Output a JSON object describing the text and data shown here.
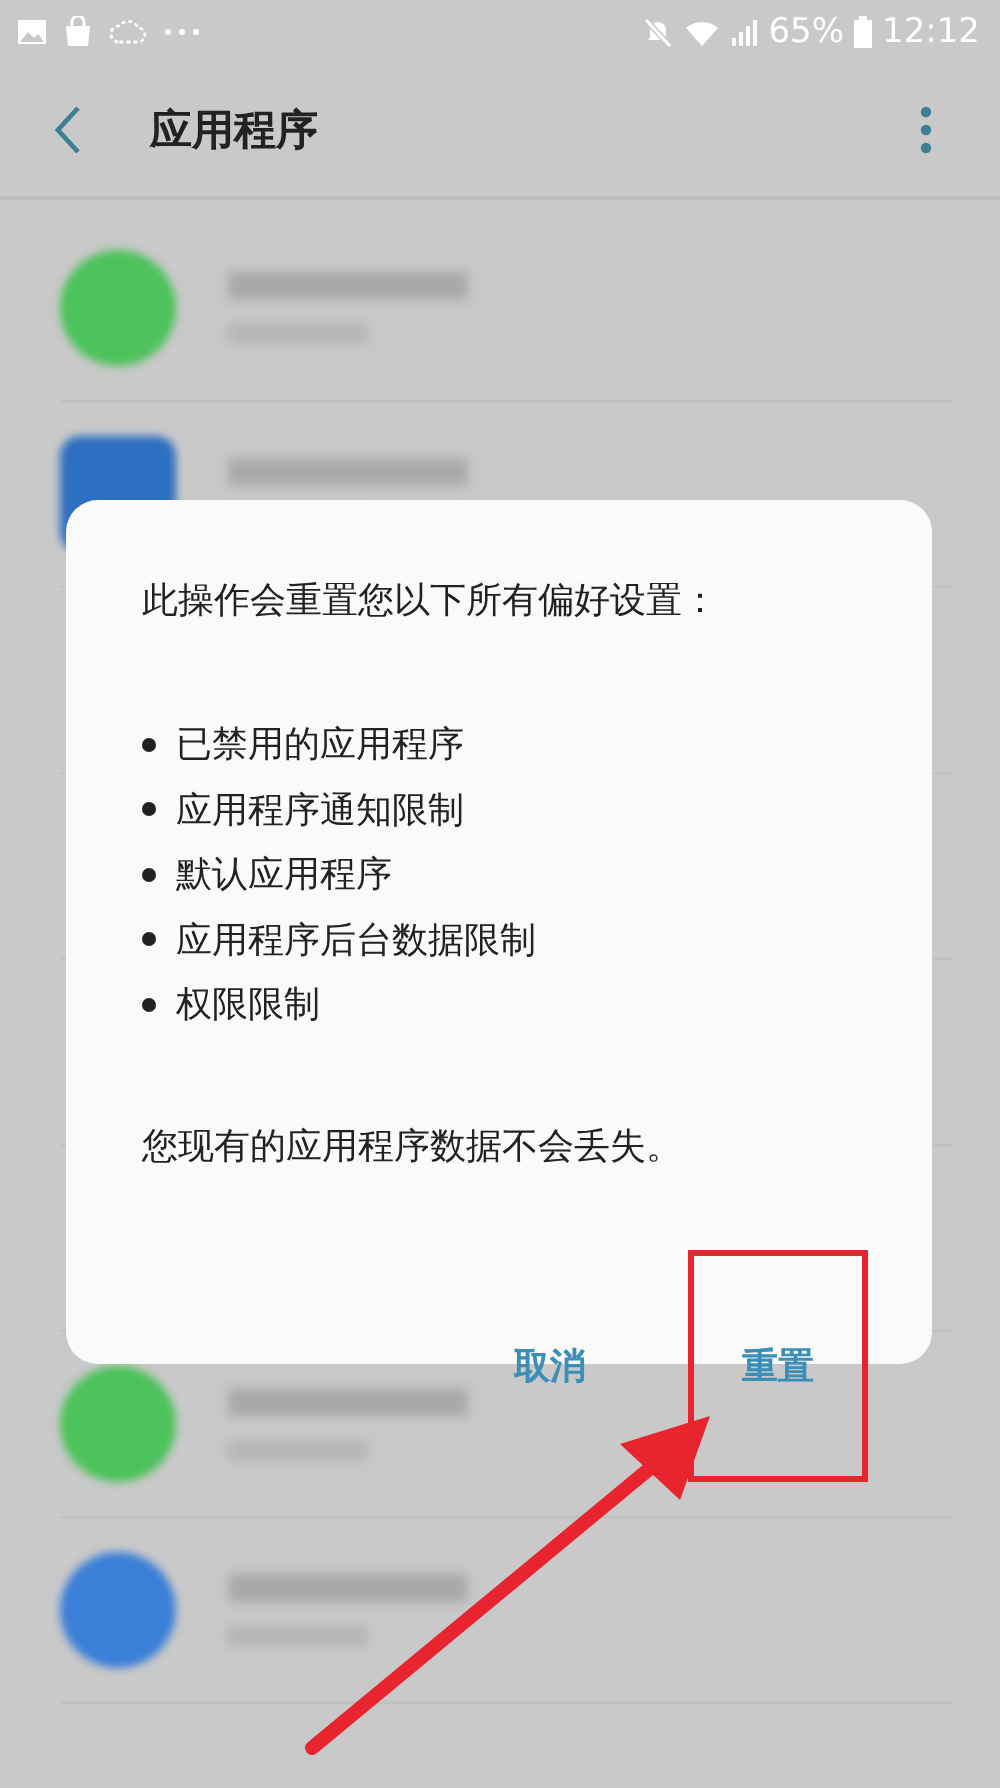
{
  "status_bar": {
    "battery": "65%",
    "time": "12:12"
  },
  "app_bar": {
    "title": "应用程序"
  },
  "app_list": [
    {
      "kind": "circle",
      "color": "#4cc25a"
    },
    {
      "kind": "square",
      "color": "#2d6fc0"
    },
    {
      "kind": "covered"
    },
    {
      "kind": "covered"
    },
    {
      "kind": "covered"
    },
    {
      "kind": "covered"
    },
    {
      "kind": "circle",
      "color": "#4cc25a"
    },
    {
      "kind": "circle",
      "color": "#3a7fd8"
    }
  ],
  "dialog": {
    "message": "此操作会重置您以下所有偏好设置：",
    "items": [
      "已禁用的应用程序",
      "应用程序通知限制",
      "默认应用程序",
      "应用程序后台数据限制",
      "权限限制"
    ],
    "note": "您现有的应用程序数据不会丢失。",
    "buttons": [
      {
        "label": "取消",
        "highlighted": false
      },
      {
        "label": "重置",
        "highlighted": true
      }
    ]
  }
}
